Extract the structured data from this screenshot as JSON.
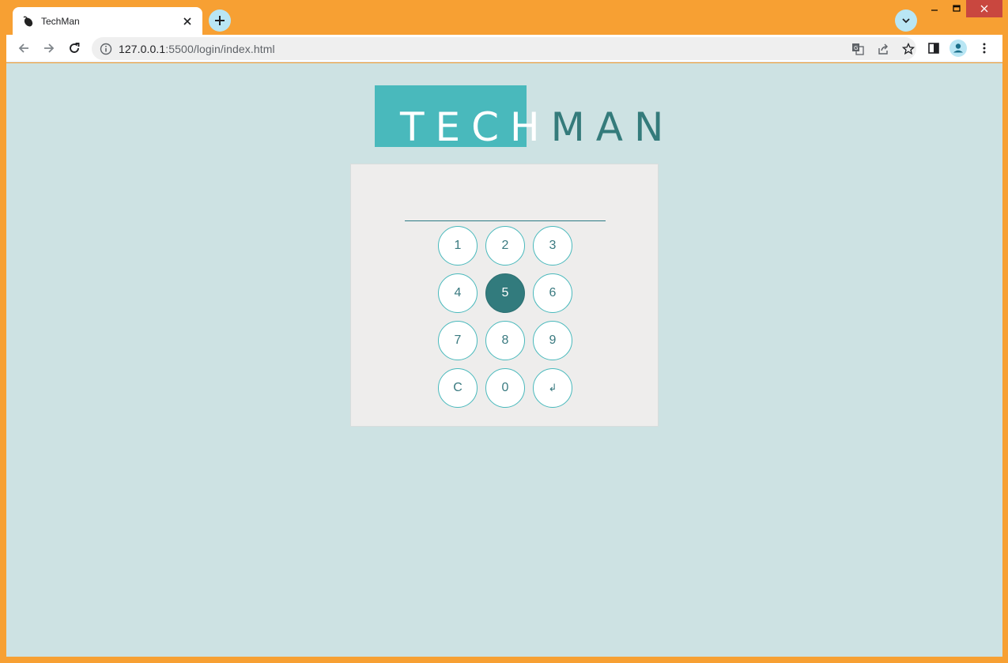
{
  "browser": {
    "tab_title": "TechMan",
    "url_host": "127.0.0.1",
    "url_rest": ":5500/login/index.html",
    "colors": {
      "frame": "#f7a033",
      "close": "#c9473f"
    }
  },
  "page": {
    "logo": {
      "part1": "TECH",
      "part2": "MAN"
    },
    "pin_value": "",
    "keys": [
      {
        "label": "1",
        "active": false
      },
      {
        "label": "2",
        "active": false
      },
      {
        "label": "3",
        "active": false
      },
      {
        "label": "4",
        "active": false
      },
      {
        "label": "5",
        "active": true
      },
      {
        "label": "6",
        "active": false
      },
      {
        "label": "7",
        "active": false
      },
      {
        "label": "8",
        "active": false
      },
      {
        "label": "9",
        "active": false
      },
      {
        "label": "C",
        "active": false
      },
      {
        "label": "0",
        "active": false
      },
      {
        "label": "↲",
        "active": false
      }
    ],
    "colors": {
      "background": "#cde2e3",
      "accent": "#49b9bc",
      "dark_teal": "#327b7d",
      "panel": "#eeedec"
    }
  }
}
